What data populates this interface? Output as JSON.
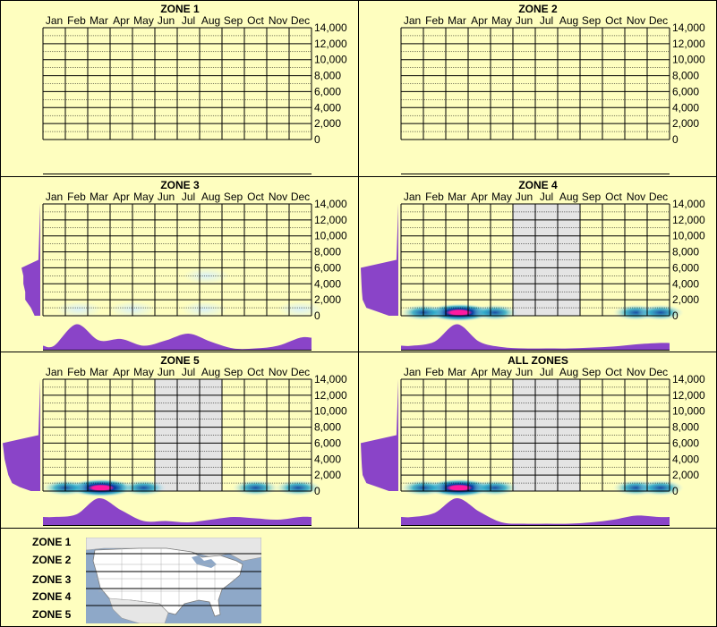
{
  "colors": {
    "background": "#fefebf",
    "grid": "#000000",
    "shaded": "#e4e4e4",
    "profile": "#8a44c8",
    "heat_low": "#d8f0f8",
    "heat_mid": "#1aa0c8",
    "heat_high": "#003aa0",
    "heat_peak": "#ff1aa0"
  },
  "chart_data": [
    {
      "type": "heatmap",
      "title": "ZONE 1",
      "months": [
        "Jan",
        "Feb",
        "Mar",
        "Apr",
        "May",
        "Jun",
        "Jul",
        "Aug",
        "Sep",
        "Oct",
        "Nov",
        "Dec"
      ],
      "yticks": [
        "14,000",
        "12,000",
        "10,000",
        "8,000",
        "6,000",
        "4,000",
        "2,000",
        "0"
      ],
      "ylim": [
        0,
        14000
      ],
      "shaded_months": [],
      "hotspots": [],
      "monthly_profile": [
        0,
        0,
        0,
        0,
        0,
        0,
        0,
        0,
        0,
        0,
        0,
        0
      ],
      "elevation_profile": []
    },
    {
      "type": "heatmap",
      "title": "ZONE 2",
      "months": [
        "Jan",
        "Feb",
        "Mar",
        "Apr",
        "May",
        "Jun",
        "Jul",
        "Aug",
        "Sep",
        "Oct",
        "Nov",
        "Dec"
      ],
      "yticks": [
        "14,000",
        "12,000",
        "10,000",
        "8,000",
        "6,000",
        "4,000",
        "2,000",
        "0"
      ],
      "ylim": [
        0,
        14000
      ],
      "shaded_months": [],
      "hotspots": [],
      "monthly_profile": [
        0,
        0,
        0,
        0,
        0,
        0,
        0,
        0,
        0,
        0,
        0,
        0
      ],
      "elevation_profile": []
    },
    {
      "type": "heatmap",
      "title": "ZONE 3",
      "months": [
        "Jan",
        "Feb",
        "Mar",
        "Apr",
        "May",
        "Jun",
        "Jul",
        "Aug",
        "Sep",
        "Oct",
        "Nov",
        "Dec"
      ],
      "yticks": [
        "14,000",
        "12,000",
        "10,000",
        "8,000",
        "6,000",
        "4,000",
        "2,000",
        "0"
      ],
      "ylim": [
        0,
        14000
      ],
      "shaded_months": [],
      "hotspots": [
        {
          "month": 1.6,
          "elev": 800,
          "level": 0.25
        },
        {
          "month": 4.0,
          "elev": 800,
          "level": 0.15
        },
        {
          "month": 7.2,
          "elev": 800,
          "level": 0.18
        },
        {
          "month": 7.3,
          "elev": 5000,
          "level": 0.12
        },
        {
          "month": 11.5,
          "elev": 800,
          "level": 0.18
        }
      ],
      "monthly_profile": [
        0.15,
        0.95,
        0.35,
        0.4,
        0.15,
        0.35,
        0.6,
        0.3,
        0.05,
        0.05,
        0.15,
        0.45
      ],
      "elevation_profile": [
        [
          0,
          0.15
        ],
        [
          1000,
          0.25
        ],
        [
          2000,
          0.4
        ],
        [
          3000,
          0.4
        ],
        [
          4000,
          0.45
        ],
        [
          5000,
          0.45
        ],
        [
          6000,
          0.5
        ],
        [
          7000,
          0.05
        ],
        [
          14000,
          0
        ]
      ]
    },
    {
      "type": "heatmap",
      "title": "ZONE 4",
      "months": [
        "Jan",
        "Feb",
        "Mar",
        "Apr",
        "May",
        "Jun",
        "Jul",
        "Aug",
        "Sep",
        "Oct",
        "Nov",
        "Dec"
      ],
      "yticks": [
        "14,000",
        "12,000",
        "10,000",
        "8,000",
        "6,000",
        "4,000",
        "2,000",
        "0"
      ],
      "ylim": [
        0,
        14000
      ],
      "shaded_months": [
        "Jun",
        "Jul",
        "Aug"
      ],
      "hotspots": [
        {
          "month": 2.6,
          "elev": 400,
          "level": 1.0
        },
        {
          "month": 1.0,
          "elev": 400,
          "level": 0.45
        },
        {
          "month": 4.2,
          "elev": 400,
          "level": 0.4
        },
        {
          "month": 10.5,
          "elev": 400,
          "level": 0.45
        },
        {
          "month": 11.6,
          "elev": 400,
          "level": 0.55
        }
      ],
      "monthly_profile": [
        0.15,
        0.3,
        0.95,
        0.3,
        0.1,
        0.05,
        0.05,
        0.05,
        0.08,
        0.12,
        0.2,
        0.25
      ],
      "elevation_profile": [
        [
          0,
          0.25
        ],
        [
          500,
          0.55
        ],
        [
          1000,
          0.85
        ],
        [
          1500,
          0.9
        ],
        [
          2000,
          0.95
        ],
        [
          3000,
          0.97
        ],
        [
          4000,
          0.98
        ],
        [
          6000,
          1.0
        ],
        [
          7000,
          0.05
        ],
        [
          14000,
          0
        ]
      ]
    },
    {
      "type": "heatmap",
      "title": "ZONE 5",
      "months": [
        "Jan",
        "Feb",
        "Mar",
        "Apr",
        "May",
        "Jun",
        "Jul",
        "Aug",
        "Sep",
        "Oct",
        "Nov",
        "Dec"
      ],
      "yticks": [
        "14,000",
        "12,000",
        "10,000",
        "8,000",
        "6,000",
        "4,000",
        "2,000",
        "0"
      ],
      "ylim": [
        0,
        14000
      ],
      "shaded_months": [
        "Jun",
        "Jul",
        "Aug"
      ],
      "hotspots": [
        {
          "month": 2.6,
          "elev": 400,
          "level": 1.0
        },
        {
          "month": 1.0,
          "elev": 400,
          "level": 0.45
        },
        {
          "month": 4.5,
          "elev": 400,
          "level": 0.4
        },
        {
          "month": 9.5,
          "elev": 400,
          "level": 0.35
        },
        {
          "month": 11.4,
          "elev": 400,
          "level": 0.45
        }
      ],
      "monthly_profile": [
        0.3,
        0.4,
        1.0,
        0.55,
        0.15,
        0.15,
        0.1,
        0.2,
        0.3,
        0.25,
        0.2,
        0.3
      ],
      "elevation_profile": [
        [
          0,
          0.25
        ],
        [
          500,
          0.55
        ],
        [
          1000,
          0.75
        ],
        [
          1500,
          0.8
        ],
        [
          2000,
          0.85
        ],
        [
          3000,
          0.9
        ],
        [
          4000,
          0.95
        ],
        [
          6000,
          1.0
        ],
        [
          7000,
          0.05
        ],
        [
          14000,
          0
        ]
      ]
    },
    {
      "type": "heatmap",
      "title": "ALL ZONES",
      "months": [
        "Jan",
        "Feb",
        "Mar",
        "Apr",
        "May",
        "Jun",
        "Jul",
        "Aug",
        "Sep",
        "Oct",
        "Nov",
        "Dec"
      ],
      "yticks": [
        "14,000",
        "12,000",
        "10,000",
        "8,000",
        "6,000",
        "4,000",
        "2,000",
        "0"
      ],
      "ylim": [
        0,
        14000
      ],
      "shaded_months": [
        "Jun",
        "Jul",
        "Aug"
      ],
      "hotspots": [
        {
          "month": 2.6,
          "elev": 400,
          "level": 1.0
        },
        {
          "month": 1.0,
          "elev": 400,
          "level": 0.45
        },
        {
          "month": 4.2,
          "elev": 400,
          "level": 0.4
        },
        {
          "month": 10.5,
          "elev": 400,
          "level": 0.45
        },
        {
          "month": 11.6,
          "elev": 400,
          "level": 0.55
        }
      ],
      "monthly_profile": [
        0.3,
        0.45,
        1.0,
        0.5,
        0.1,
        0.05,
        0.05,
        0.05,
        0.1,
        0.2,
        0.35,
        0.3
      ],
      "elevation_profile": [
        [
          0,
          0.25
        ],
        [
          500,
          0.55
        ],
        [
          1000,
          0.85
        ],
        [
          1500,
          0.9
        ],
        [
          2000,
          0.95
        ],
        [
          3000,
          0.97
        ],
        [
          4000,
          0.98
        ],
        [
          6000,
          1.0
        ],
        [
          7000,
          0.05
        ],
        [
          14000,
          0
        ]
      ]
    }
  ],
  "legend": {
    "zones": [
      "ZONE 1",
      "ZONE 2",
      "ZONE 3",
      "ZONE 4",
      "ZONE 5"
    ],
    "map_icon": "us-map-icon"
  }
}
